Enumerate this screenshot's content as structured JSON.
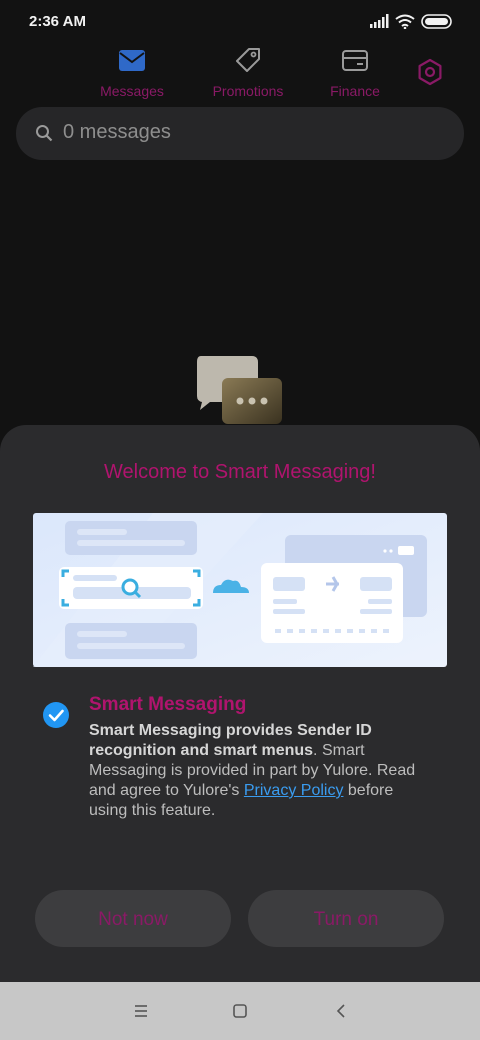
{
  "status": {
    "time": "2:36 AM"
  },
  "tabs": [
    {
      "label": "Messages",
      "icon": "envelope-icon"
    },
    {
      "label": "Promotions",
      "icon": "tag-icon"
    },
    {
      "label": "Finance",
      "icon": "card-icon"
    }
  ],
  "search": {
    "placeholder": "0 messages"
  },
  "sheet": {
    "title": "Welcome to Smart Messaging!",
    "option_title": "Smart Messaging",
    "desc_bold": "Smart Messaging provides Sender ID recognition and smart menus",
    "desc_text": ". Smart Messaging is provided in part by Yulore. Read and agree to Yulore's ",
    "desc_link": "Privacy Policy",
    "desc_tail": " before using this feature.",
    "checked": true,
    "not_now_label": "Not now",
    "turn_on_label": "Turn on"
  },
  "colors": {
    "accent": "#b0146e",
    "link": "#3a9cf0",
    "check": "#2196f3"
  }
}
